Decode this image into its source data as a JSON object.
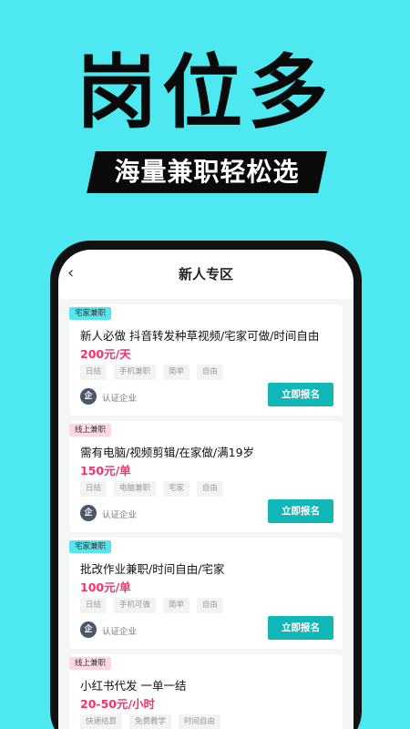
{
  "hero": {
    "headline": "岗位多",
    "subheadline": "海量兼职轻松选"
  },
  "nav": {
    "back_icon": "chevron-left-icon",
    "title": "新人专区"
  },
  "jobs": [
    {
      "badge": "宅家兼职",
      "badge_color": "#57e6ef",
      "title": "新人必做  抖音转发种草视频/宅家可做/时间自由",
      "salary": "200元/天",
      "tags": [
        "日结",
        "手机兼职",
        "简单",
        "自由"
      ],
      "company_icon_text": "企",
      "company_label": "认证企业",
      "apply_label": "立即报名"
    },
    {
      "badge": "线上兼职",
      "badge_color": "#ffd6e2",
      "title": "需有电脑/视频剪辑/在家做/满19岁",
      "salary": "150元/单",
      "tags": [
        "日结",
        "电脑兼职",
        "宅家",
        "自由"
      ],
      "company_icon_text": "企",
      "company_label": "认证企业",
      "apply_label": "立即报名"
    },
    {
      "badge": "宅家兼职",
      "badge_color": "#57e6ef",
      "title": "批改作业兼职/时间自由/宅家",
      "salary": "100元/单",
      "tags": [
        "日结",
        "手机可做",
        "简单",
        "自由"
      ],
      "company_icon_text": "企",
      "company_label": "认证企业",
      "apply_label": "立即报名"
    },
    {
      "badge": "线上兼职",
      "badge_color": "#ffd6e2",
      "title": "小红书代发  一单一结",
      "salary": "20-50元/小时",
      "tags": [
        "快速结算",
        "免费教学",
        "时间自由"
      ]
    }
  ],
  "colors": {
    "background": "#4ee8f0",
    "accent_button": "#12b8b8",
    "salary": "#ff2d6a"
  }
}
